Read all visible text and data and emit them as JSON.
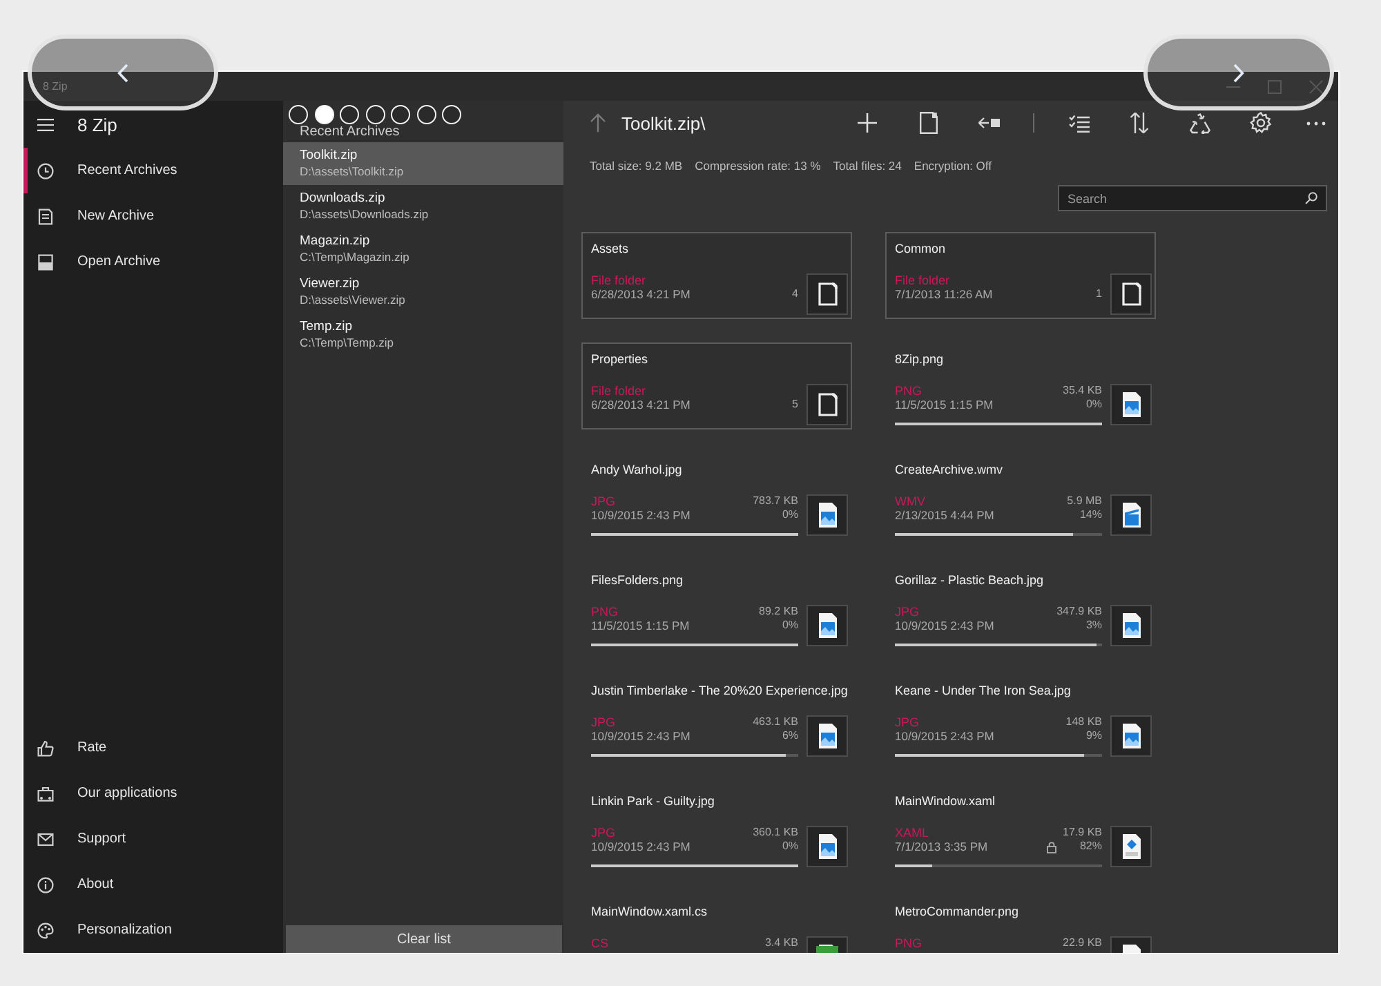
{
  "carousel": {
    "dots": [
      {
        "selected": false
      },
      {
        "selected": true
      },
      {
        "selected": false
      },
      {
        "selected": false
      },
      {
        "selected": false
      },
      {
        "selected": false
      },
      {
        "selected": false
      }
    ]
  },
  "window": {
    "title": "8 Zip"
  },
  "nav": {
    "app_name": "8 Zip",
    "items": [
      {
        "label": "Recent Archives",
        "selected": true
      },
      {
        "label": "New Archive",
        "selected": false
      },
      {
        "label": "Open Archive",
        "selected": false
      }
    ],
    "footer_items": [
      {
        "label": "Rate",
        "selected": false
      },
      {
        "label": "Our applications",
        "selected": false
      },
      {
        "label": "Support",
        "selected": false
      },
      {
        "label": "About",
        "selected": false
      },
      {
        "label": "Personalization",
        "selected": false
      }
    ]
  },
  "recent": {
    "title": "Recent Archives",
    "items": [
      {
        "name": "Toolkit.zip",
        "path": "D:\\assets\\Toolkit.zip",
        "selected": true
      },
      {
        "name": "Downloads.zip",
        "path": "D:\\assets\\Downloads.zip",
        "selected": false
      },
      {
        "name": "Magazin.zip",
        "path": "C:\\Temp\\Magazin.zip",
        "selected": false
      },
      {
        "name": "Viewer.zip",
        "path": "D:\\assets\\Viewer.zip",
        "selected": false
      },
      {
        "name": "Temp.zip",
        "path": "C:\\Temp\\Temp.zip",
        "selected": false
      }
    ],
    "clear_button": "Clear list"
  },
  "toolbar": {
    "path": "Toolkit.zip\\"
  },
  "summary": [
    "Total size: 9.2 MB",
    "Compression rate: 13 %",
    "Total files: 24",
    "Encryption: Off"
  ],
  "search": {
    "placeholder": "Search"
  },
  "items": [
    {
      "kind": "folder",
      "name": "Assets",
      "type": "File folder",
      "date": "6/28/2013 4:21 PM",
      "count": "4",
      "locked": false
    },
    {
      "kind": "folder",
      "name": "Common",
      "type": "File folder",
      "date": "7/1/2013 11:26 AM",
      "count": "1",
      "locked": false
    },
    {
      "kind": "folder",
      "name": "Properties",
      "type": "File folder",
      "date": "6/28/2013 4:21 PM",
      "count": "5",
      "locked": false
    },
    {
      "kind": "image",
      "name": "8Zip.png",
      "type": "PNG",
      "date": "11/5/2015 1:15 PM",
      "size": "35.4 KB",
      "ratio": "0%",
      "level": 1,
      "locked": false
    },
    {
      "kind": "image",
      "name": "Andy Warhol.jpg",
      "type": "JPG",
      "date": "10/9/2015 2:43 PM",
      "size": "783.7 KB",
      "ratio": "0%",
      "level": 1,
      "locked": false
    },
    {
      "kind": "video",
      "name": "CreateArchive.wmv",
      "type": "WMV",
      "date": "2/13/2015 4:44 PM",
      "size": "5.9 MB",
      "ratio": "14%",
      "level": 0.86,
      "locked": false
    },
    {
      "kind": "image",
      "name": "FilesFolders.png",
      "type": "PNG",
      "date": "11/5/2015 1:15 PM",
      "size": "89.2 KB",
      "ratio": "0%",
      "level": 1,
      "locked": false
    },
    {
      "kind": "image",
      "name": "Gorillaz - Plastic Beach.jpg",
      "type": "JPG",
      "date": "10/9/2015 2:43 PM",
      "size": "347.9 KB",
      "ratio": "3%",
      "level": 0.97,
      "locked": false
    },
    {
      "kind": "image",
      "name": "Justin Timberlake - The 20%20 Experience.jpg",
      "type": "JPG",
      "date": "10/9/2015 2:43 PM",
      "size": "463.1 KB",
      "ratio": "6%",
      "level": 0.94,
      "locked": false
    },
    {
      "kind": "image",
      "name": "Keane - Under The Iron Sea.jpg",
      "type": "JPG",
      "date": "10/9/2015 2:43 PM",
      "size": "148 KB",
      "ratio": "9%",
      "level": 0.91,
      "locked": false
    },
    {
      "kind": "image",
      "name": "Linkin Park - Guilty.jpg",
      "type": "JPG",
      "date": "10/9/2015 2:43 PM",
      "size": "360.1 KB",
      "ratio": "0%",
      "level": 1,
      "locked": false
    },
    {
      "kind": "markup",
      "name": "MainWindow.xaml",
      "type": "XAML",
      "date": "7/1/2013 3:35 PM",
      "size": "17.9 KB",
      "ratio": "82%",
      "level": 0.18,
      "locked": true
    },
    {
      "kind": "code",
      "name": "MainWindow.xaml.cs",
      "type": "CS",
      "size": "3.4 KB",
      "locked": false
    },
    {
      "kind": "image",
      "name": "MetroCommander.png",
      "type": "PNG",
      "size": "22.9 KB",
      "locked": false
    }
  ]
}
